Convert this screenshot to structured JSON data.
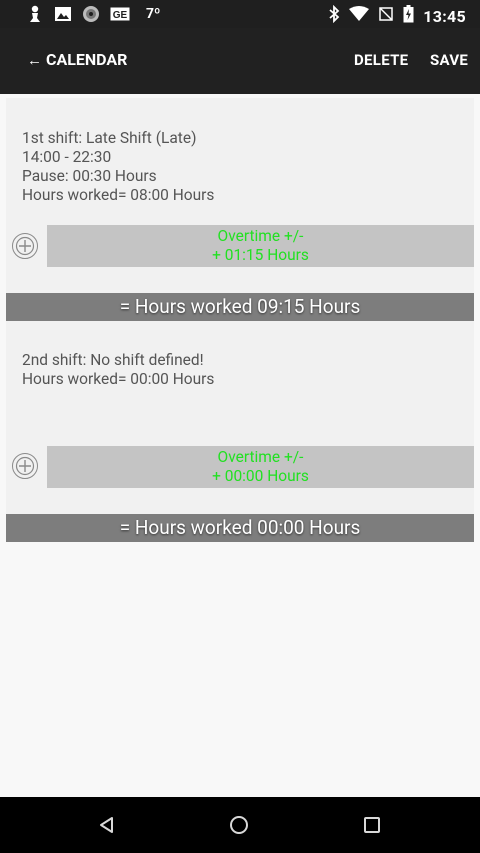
{
  "status_bar": {
    "left_icons": [
      "chess-pawn-icon",
      "image-icon",
      "cd-icon",
      "ge-icon"
    ],
    "ge_label": "GE",
    "temperature": "7º",
    "right_icons": [
      "bluetooth-icon",
      "wifi-icon",
      "no-sim-icon",
      "battery-icon"
    ],
    "time": "13:45"
  },
  "toolbar": {
    "back_label": "CALENDAR",
    "delete_label": "DELETE",
    "save_label": "SAVE",
    "background": "#212121"
  },
  "shifts": [
    {
      "title": "1st shift: Late Shift (Late)",
      "time_range": "14:00 - 22:30",
      "pause": "Pause: 00:30 Hours",
      "hours_worked": "Hours worked= 08:00 Hours",
      "overtime_label": "Overtime +/-",
      "overtime_value": "+ 01:15 Hours",
      "total": "= Hours worked 09:15 Hours"
    },
    {
      "title": "2nd shift: No shift defined!",
      "hours_worked": "Hours worked= 00:00 Hours",
      "overtime_label": "Overtime +/-",
      "overtime_value": "+ 00:00 Hours",
      "total": "= Hours worked 00:00 Hours"
    }
  ],
  "colors": {
    "overtime_text": "#22e022",
    "overtime_box": "#c4c4c4",
    "total_bar": "#7d7d7d"
  },
  "nav_bar": {
    "icons": [
      "back-triangle-icon",
      "home-circle-icon",
      "recents-square-icon"
    ]
  }
}
